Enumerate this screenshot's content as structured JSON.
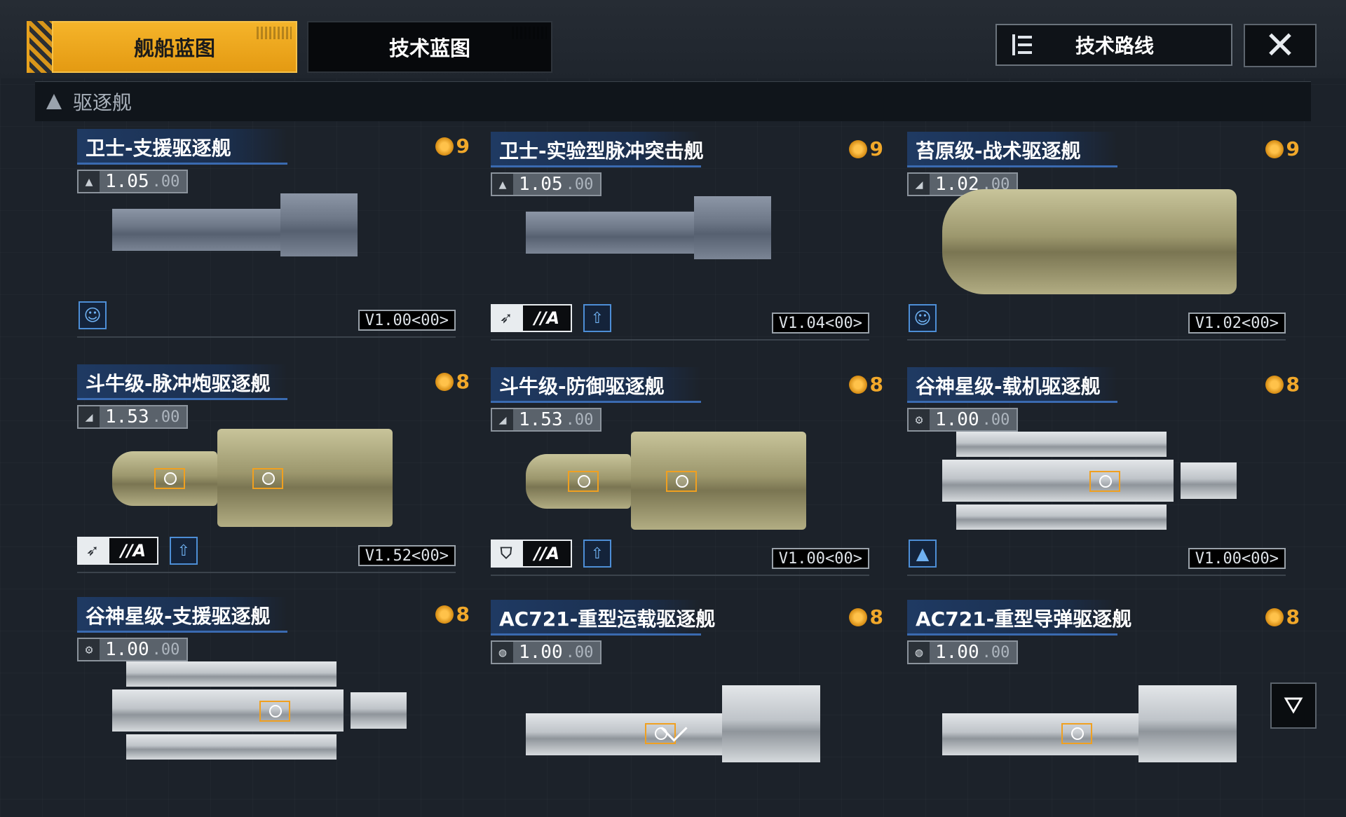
{
  "tabs": {
    "active": "舰船蓝图",
    "inactive": "技术蓝图"
  },
  "tech_route_label": "技术路线",
  "close_glyph": "✕",
  "section_title": "驱逐舰",
  "cost_icon": "cost-icon",
  "cards": [
    {
      "name": "卫士-支援驱逐舰",
      "cost": "9",
      "stat_main": "1.05",
      "stat_dec": ".00",
      "stat_icon": "▲",
      "version": "V1.00<00>",
      "style": "grey",
      "role": "support"
    },
    {
      "name": "卫士-实验型脉冲突击舰",
      "cost": "9",
      "stat_main": "1.05",
      "stat_dec": ".00",
      "stat_icon": "▲",
      "version": "V1.04<00>",
      "style": "grey",
      "role": "tags",
      "tagB": "//A"
    },
    {
      "name": "苔原级-战术驱逐舰",
      "cost": "9",
      "stat_main": "1.02",
      "stat_dec": ".00",
      "stat_icon": "◢",
      "version": "V1.02<00>",
      "style": "olive-big",
      "role": "support"
    },
    {
      "name": "斗牛级-脉冲炮驱逐舰",
      "cost": "8",
      "stat_main": "1.53",
      "stat_dec": ".00",
      "stat_icon": "◢",
      "version": "V1.52<00>",
      "style": "olive",
      "role": "tags",
      "tagB": "//A"
    },
    {
      "name": "斗牛级-防御驱逐舰",
      "cost": "8",
      "stat_main": "1.53",
      "stat_dec": ".00",
      "stat_icon": "◢",
      "version": "V1.00<00>",
      "style": "olive",
      "role": "tags-shield",
      "tagB": "//A"
    },
    {
      "name": "谷神星级-载机驱逐舰",
      "cost": "8",
      "stat_main": "1.00",
      "stat_dec": ".00",
      "stat_icon": "⚙",
      "version": "V1.00<00>",
      "style": "white",
      "role": "carrier"
    },
    {
      "name": "谷神星级-支援驱逐舰",
      "cost": "8",
      "stat_main": "1.00",
      "stat_dec": ".00",
      "stat_icon": "⚙",
      "version": "",
      "style": "white",
      "role": "none"
    },
    {
      "name": "AC721-重型运载驱逐舰",
      "cost": "8",
      "stat_main": "1.00",
      "stat_dec": ".00",
      "stat_icon": "◍",
      "version": "",
      "style": "white2",
      "role": "none"
    },
    {
      "name": "AC721-重型导弹驱逐舰",
      "cost": "8",
      "stat_main": "1.00",
      "stat_dec": ".00",
      "stat_icon": "◍",
      "version": "",
      "style": "white2",
      "role": "none"
    }
  ],
  "colors": {
    "accent": "#f1a82a",
    "name_bar": "#1f3a63",
    "blue_icon": "#4d8ed6"
  }
}
